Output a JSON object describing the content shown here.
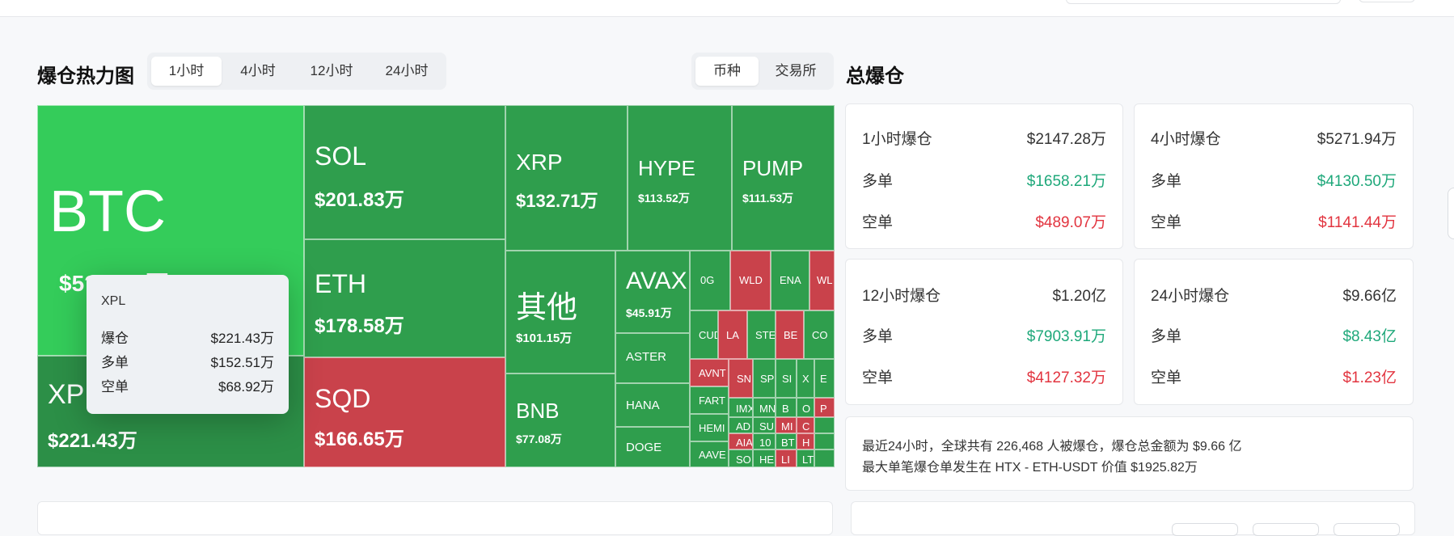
{
  "heatmap": {
    "title": "爆仓热力图",
    "time_tabs": [
      "1小时",
      "4小时",
      "12小时",
      "24小时"
    ],
    "active_time_tab": "1小时",
    "group_tabs": [
      "币种",
      "交易所"
    ],
    "active_group_tab": "币种",
    "tiles": {
      "btc": {
        "symbol": "BTC",
        "amount": "$5??.??万"
      },
      "xpl": {
        "symbol": "XPL",
        "amount": "$221.43万"
      },
      "sol": {
        "symbol": "SOL",
        "amount": "$201.83万"
      },
      "eth": {
        "symbol": "ETH",
        "amount": "$178.58万"
      },
      "sqd": {
        "symbol": "SQD",
        "amount": "$166.65万"
      },
      "xrp": {
        "symbol": "XRP",
        "amount": "$132.71万"
      },
      "hype": {
        "symbol": "HYPE",
        "amount": "$113.52万"
      },
      "pump": {
        "symbol": "PUMP",
        "amount": "$111.53万"
      },
      "other": {
        "symbol": "其他",
        "amount": "$101.15万"
      },
      "bnb": {
        "symbol": "BNB",
        "amount": "$77.08万"
      },
      "avax": {
        "symbol": "AVAX",
        "amount": "$45.91万"
      },
      "aster": {
        "symbol": "ASTER"
      },
      "hana": {
        "symbol": "HANA"
      },
      "doge": {
        "symbol": "DOGE"
      },
      "og": {
        "symbol": "0G"
      },
      "wld": {
        "symbol": "WLD"
      },
      "ena": {
        "symbol": "ENA"
      },
      "wl": {
        "symbol": "WL"
      },
      "cud": {
        "symbol": "CUD"
      },
      "la": {
        "symbol": "LA"
      },
      "ste": {
        "symbol": "STE"
      },
      "be": {
        "symbol": "BE"
      },
      "co": {
        "symbol": "CO"
      },
      "avnt": {
        "symbol": "AVNT"
      },
      "sn": {
        "symbol": "SN"
      },
      "sp": {
        "symbol": "SP"
      },
      "si": {
        "symbol": "SI"
      },
      "x": {
        "symbol": "X"
      },
      "e": {
        "symbol": "E"
      },
      "fart": {
        "symbol": "FART"
      },
      "imx": {
        "symbol": "IMX"
      },
      "mn": {
        "symbol": "MN"
      },
      "b1": {
        "symbol": "B"
      },
      "o": {
        "symbol": "O"
      },
      "p": {
        "symbol": "P"
      },
      "hemi": {
        "symbol": "HEMI"
      },
      "ad": {
        "symbol": "AD"
      },
      "su": {
        "symbol": "SU"
      },
      "mi": {
        "symbol": "MI"
      },
      "c": {
        "symbol": "C"
      },
      "h": {
        "symbol": "H"
      },
      "aia": {
        "symbol": "AIA"
      },
      "n10": {
        "symbol": "10"
      },
      "bt": {
        "symbol": "BT"
      },
      "aave": {
        "symbol": "AAVE"
      },
      "so": {
        "symbol": "SO"
      },
      "he": {
        "symbol": "HE"
      },
      "li": {
        "symbol": "LI"
      },
      "lt": {
        "symbol": "LT"
      }
    },
    "tooltip": {
      "name": "XPL",
      "liq_label": "爆仓",
      "liq_value": "$221.43万",
      "long_label": "多单",
      "long_value": "$152.51万",
      "short_label": "空单",
      "short_value": "$68.92万"
    }
  },
  "totals": {
    "title": "总爆仓",
    "long_label": "多单",
    "short_label": "空单",
    "cards": [
      {
        "label": "1小时爆仓",
        "total": "$2147.28万",
        "long": "$1658.21万",
        "short": "$489.07万"
      },
      {
        "label": "4小时爆仓",
        "total": "$5271.94万",
        "long": "$4130.50万",
        "short": "$1141.44万"
      },
      {
        "label": "12小时爆仓",
        "total": "$1.20亿",
        "long": "$7903.91万",
        "short": "$4127.32万"
      },
      {
        "label": "24小时爆仓",
        "total": "$9.66亿",
        "long": "$8.43亿",
        "short": "$1.23亿"
      }
    ],
    "summary_line1": "最近24小时，全球共有 226,468 人被爆仓，爆仓总金额为 $9.66 亿",
    "summary_line2": "最大单笔爆仓单发生在 HTX - ETH-USDT 价值 $1925.82万"
  },
  "colors": {
    "long_green": "#1ea87a",
    "short_red": "#e2343f",
    "tile_green": "#2f9e4d",
    "tile_bright_green": "#34cc5a",
    "tile_red": "#c9424b"
  }
}
